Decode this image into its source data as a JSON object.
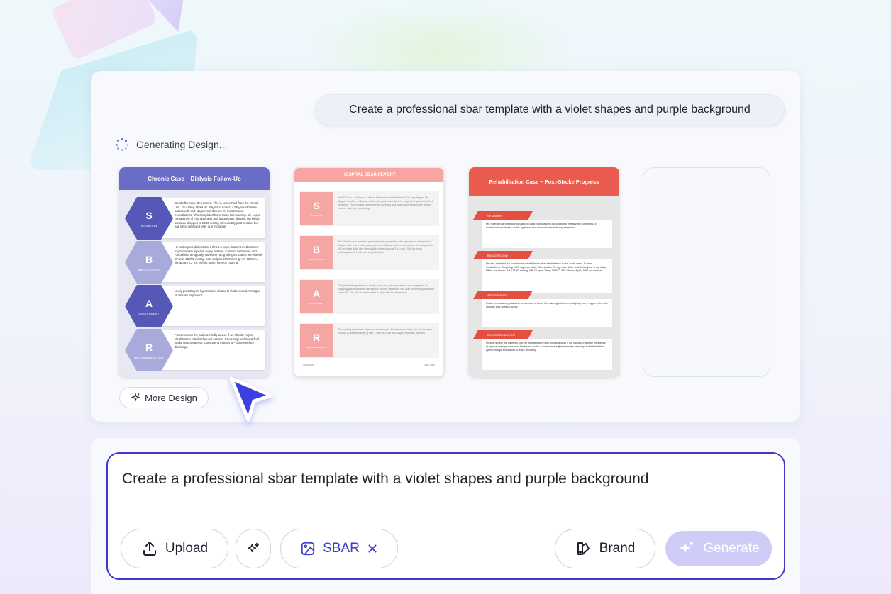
{
  "prompt_bubble": "Create a professional sbar template with a violet shapes and purple background",
  "status": "Generating Design...",
  "thumbs": {
    "t1": {
      "title": "Chronic Case – Dialysis Follow-Up",
      "rows": [
        {
          "letter": "S",
          "label": "SITUATION",
          "text": "Good afternoon, Dr. Herrera. This is Nurse Paul from the Renal Unit. I'm calling about Mr. Raymond Lopez, a 55-year-old male patient with end-stage renal disease on maintenance hemodialysis, who completed his session this morning. Mr. Lopez complained of mild dizziness and fatigue after dialysis. His blood pressure dropped to 90/60 mmHg immediately post-session but has since improved after oral hydration."
        },
        {
          "letter": "B",
          "label": "BACKGROUND",
          "text": "He undergoes dialysis three times a week. Current medications: Erythropoietin injection every session, Calcium carbonate, and Amlodipine 5 mg daily. No known drug allergies. Latest pre-dialysis BP was 138/85 mmHg, post-dialysis 90/60 mmHg, HR 88 bpm, Temp 36.7°C, RR 20/min, SpO₂ 96% on room air."
        },
        {
          "letter": "A",
          "label": "ASSESSMENT",
          "text": "Likely post-dialysis hypotension related to fluid removal. No signs of distress at present."
        },
        {
          "letter": "R",
          "label": "RECOMMENDATION",
          "text": "Please review the patient. Kindly advise if we should: Adjust ultrafiltration rate for the next session. Encourage additional fluid intake post-treatment. Continue to monitor BP closely before discharge."
        }
      ]
    },
    "t2": {
      "title": "HOSPITAL SBAR REPORT",
      "rows": [
        {
          "letter": "S",
          "label": "SITUATION",
          "text": "At 0830 hrs, I am Nurse Julianne Reyes from Medical Ward 3A, reporting on Ms. Angela Castillo, a 68-year-old female patient admitted for suspected gastrointestinal bleeding. This morning, she reported dizziness and was found hypotensive during routine vital sign monitoring."
        },
        {
          "letter": "B",
          "label": "BACKGROUND",
          "text": "Ms. Castillo was admitted yesterday after presenting with episodes of melena and fatigue. She has a history of peptic ulcer disease and is currently on IV pantoprazole 40 mg twice daily. Her hemoglobin yesterday was 10.4 g/dL. She is not on anticoagulants. No known drug allergies."
        },
        {
          "letter": "A",
          "label": "ASSESSMENT",
          "text": "The patient's hypotension, tachycardia, and pale appearance are suggestive of ongoing gastrointestinal bleeding or volume depletion. She may be hemodynamically unstable. The risk of deterioration is high without intervention."
        },
        {
          "letter": "R",
          "label": "RECOMMENDATION",
          "text": "Requesting immediate physician assessment. Please advise if we should: Increase IV fluid (Lactated Ringer's) rate. Order an H&H test. Adjust antibiotic regimen."
        }
      ],
      "foot_left": "Signature",
      "foot_right": "Date/Time"
    },
    "t3": {
      "title": "Rehabilitation Case – Post-Stroke Progress",
      "rows": [
        {
          "label": "SITUATION",
          "text": "Mr. Ramos has been participating in daily physical and occupational therapy but continues to experience weakness on his right arm and slurred speech during sessions."
        },
        {
          "label": "BACKGROUND",
          "text": "He was admitted for post-stroke rehabilitation after stabilization in the acute ward. Current medications: Clopidogrel 75 mg once daily, Atorvastatin 20 mg once daily, and Amlodipine 5 mg daily. Vitals are stable: BP 124/80 mmHg, HR 78 bpm, Temp 36.6°C, RR 18/min, SpO₂ 98% on room air."
        },
        {
          "label": "ASSESSMENT",
          "text": "Patient is showing gradual improvement in lower limb strength but minimal progress in upper extremity mobility and speech clarity."
        },
        {
          "label": "RECOMMENDATION",
          "text": "Please review the patient's current rehabilitation plan. Kindly advise if we should: Increase frequency of speech therapy sessions. Reassess motor function and adjust exercise intensity. Schedule follow-up neurologic evaluation to track recovery."
        }
      ]
    }
  },
  "more_design": "More Design",
  "input": {
    "value": "Create a professional sbar template with a violet shapes and purple background",
    "upload": "Upload",
    "sbar": "SBAR",
    "brand": "Brand",
    "generate": "Generate"
  },
  "colors": {
    "accent": "#4338ca",
    "violet": "#6a6dc8",
    "coral": "#ea5b4f",
    "pink": "#f7a4a2"
  }
}
